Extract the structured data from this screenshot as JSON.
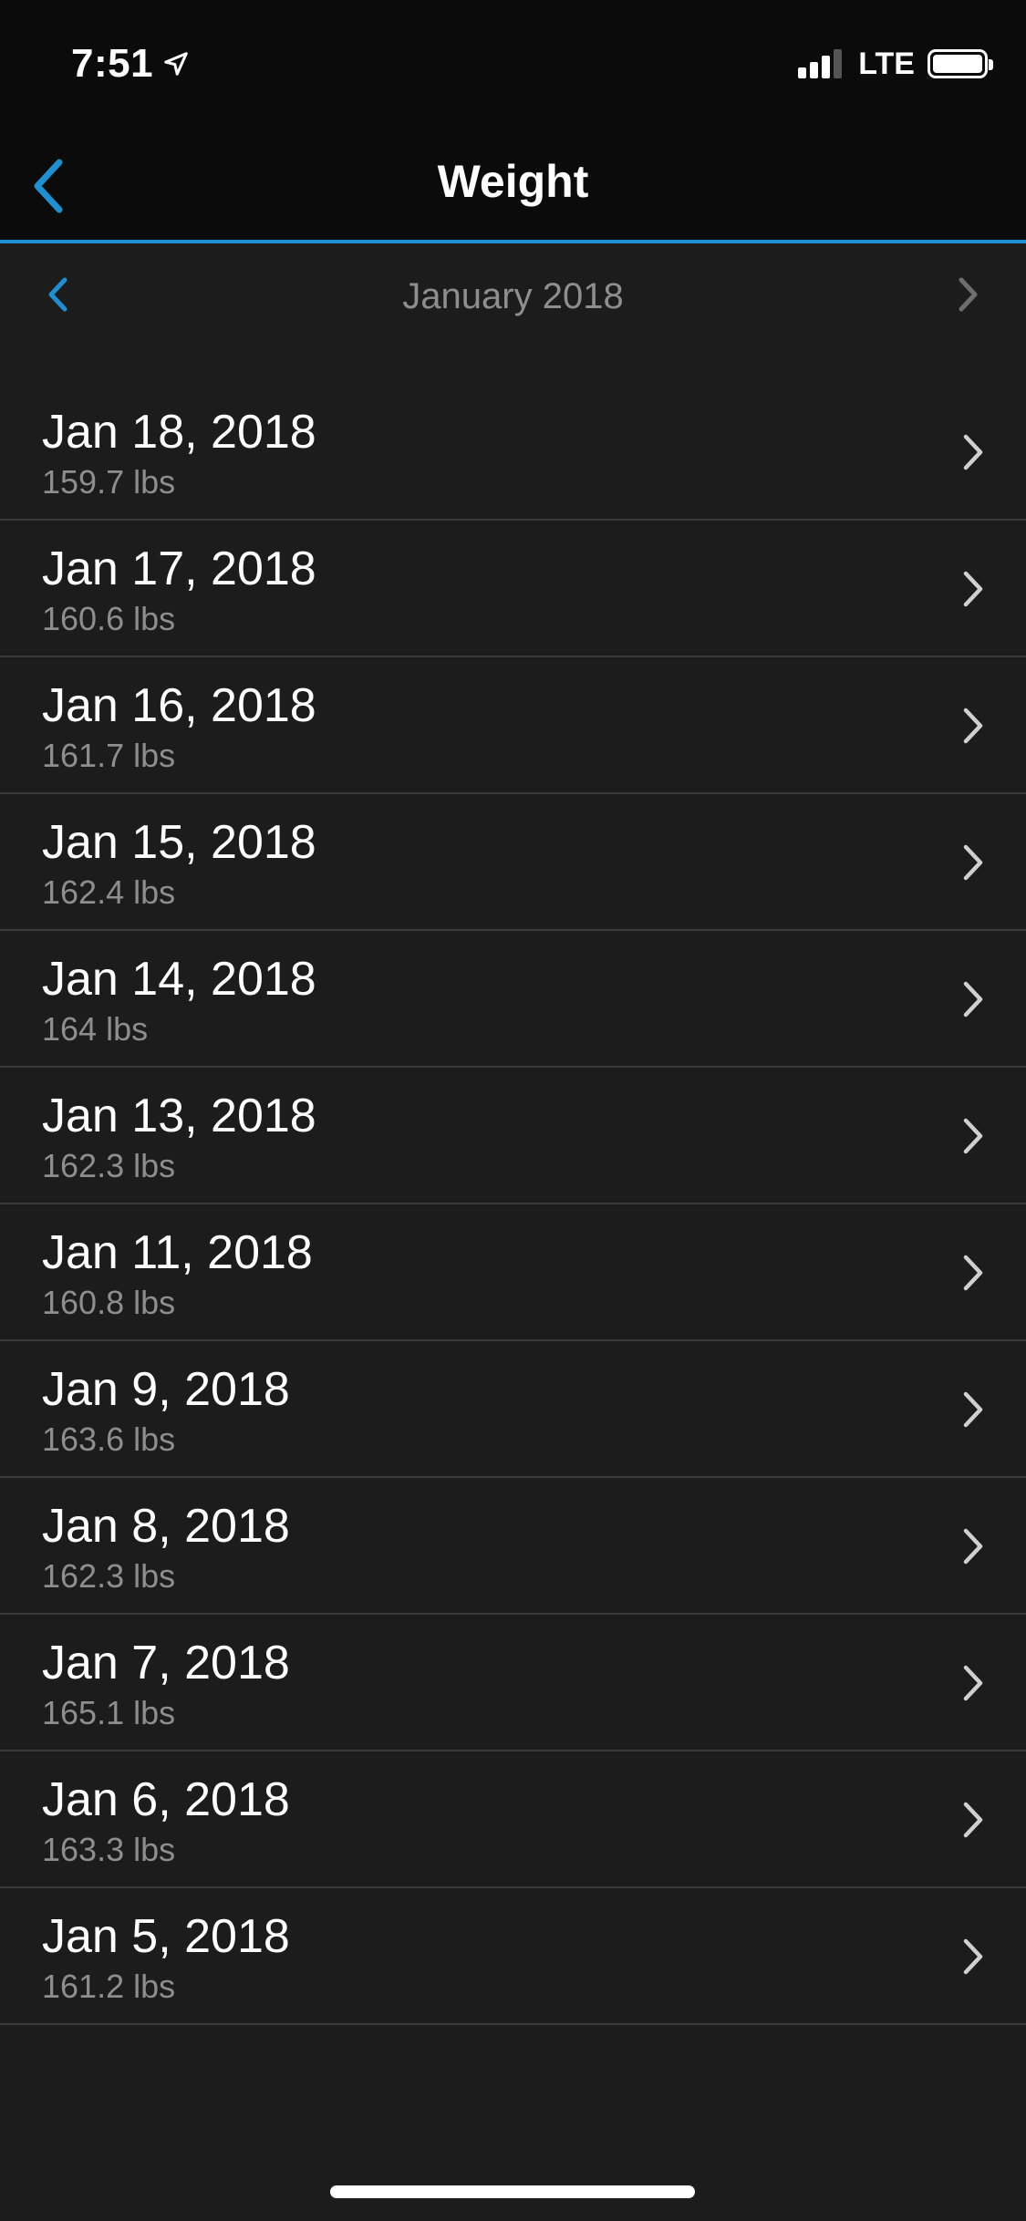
{
  "status_bar": {
    "time": "7:51",
    "network": "LTE",
    "location_icon": "location-arrow-icon",
    "signal_icon": "cellular-signal-icon",
    "battery_icon": "battery-full-icon"
  },
  "nav": {
    "title": "Weight",
    "back_icon": "chevron-left-icon"
  },
  "month_selector": {
    "label": "January 2018",
    "prev_icon": "chevron-left-icon",
    "next_icon": "chevron-right-icon"
  },
  "colors": {
    "accent": "#1e8fd0",
    "background": "#1c1c1c",
    "header_background": "#0b0b0b",
    "primary_text": "#ffffff",
    "secondary_text": "#8e8e8e",
    "divider": "#3a3a3a"
  },
  "entries": [
    {
      "date": "Jan 18, 2018",
      "weight": "159.7 lbs"
    },
    {
      "date": "Jan 17, 2018",
      "weight": "160.6 lbs"
    },
    {
      "date": "Jan 16, 2018",
      "weight": "161.7 lbs"
    },
    {
      "date": "Jan 15, 2018",
      "weight": "162.4 lbs"
    },
    {
      "date": "Jan 14, 2018",
      "weight": "164 lbs"
    },
    {
      "date": "Jan 13, 2018",
      "weight": "162.3 lbs"
    },
    {
      "date": "Jan 11, 2018",
      "weight": "160.8 lbs"
    },
    {
      "date": "Jan 9, 2018",
      "weight": "163.6 lbs"
    },
    {
      "date": "Jan 8, 2018",
      "weight": "162.3 lbs"
    },
    {
      "date": "Jan 7, 2018",
      "weight": "165.1 lbs"
    },
    {
      "date": "Jan 6, 2018",
      "weight": "163.3 lbs"
    },
    {
      "date": "Jan 5, 2018",
      "weight": "161.2 lbs"
    }
  ]
}
